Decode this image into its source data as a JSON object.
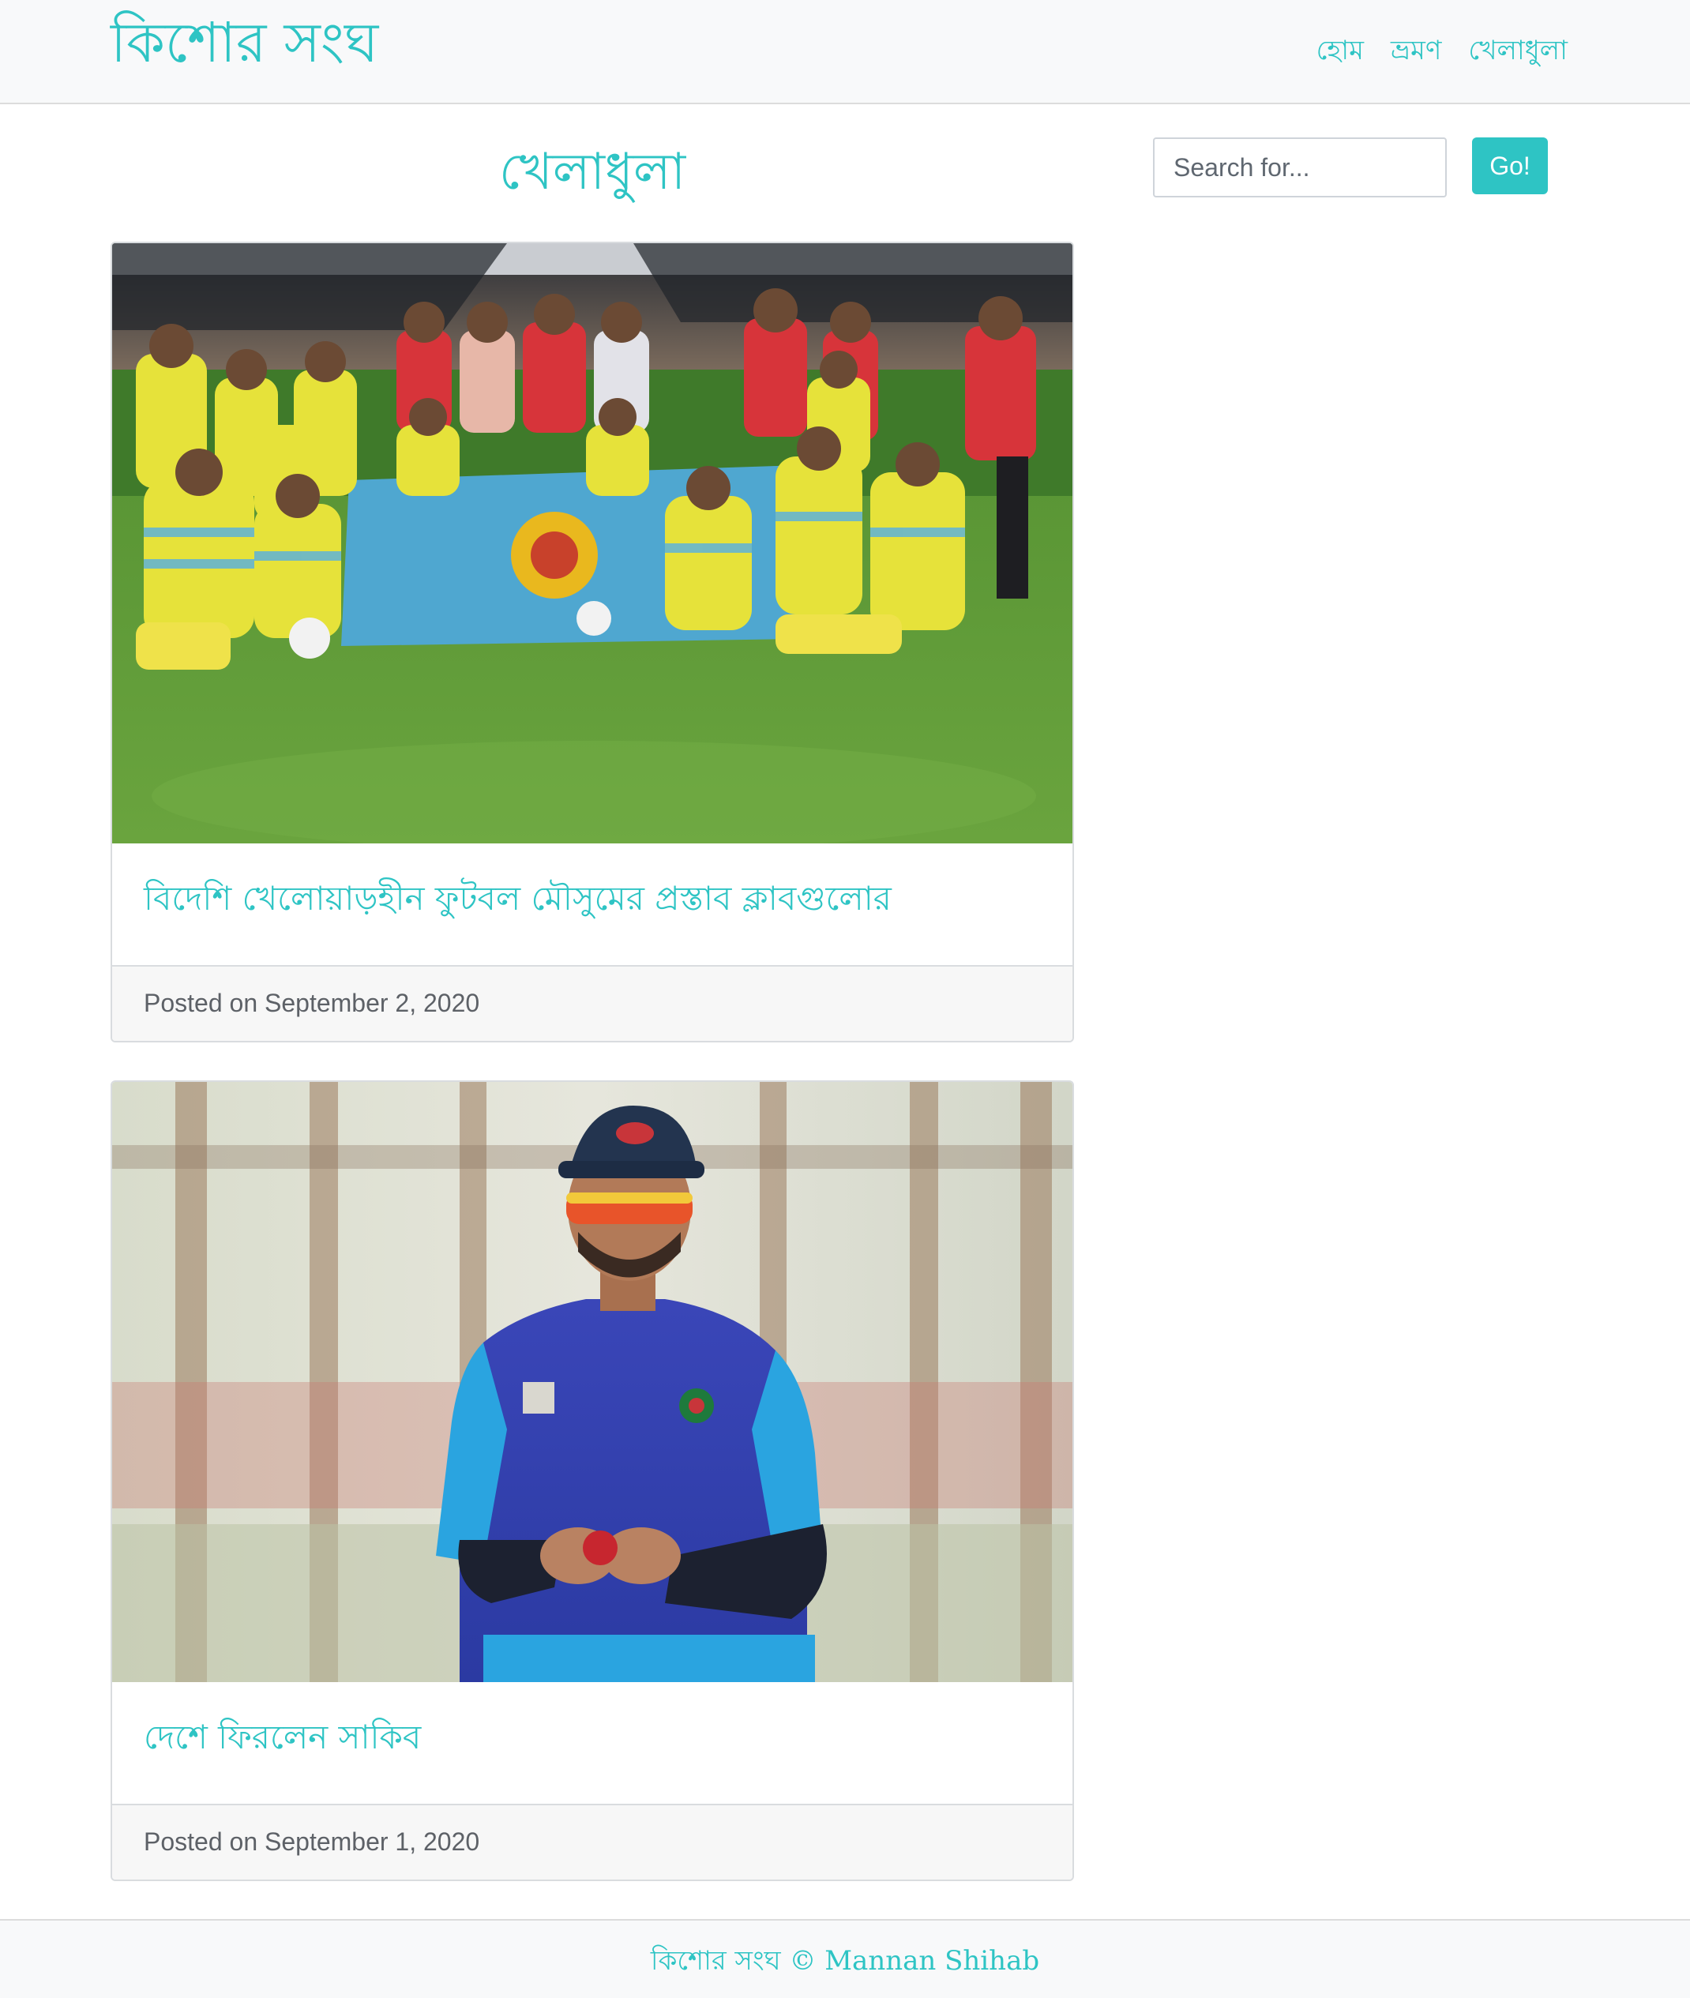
{
  "navbar": {
    "brand": "কিশোর সংঘ",
    "links": [
      "হোম",
      "ভ্রমণ",
      "খেলাধুলা"
    ]
  },
  "page": {
    "heading": "খেলাধুলা"
  },
  "search": {
    "placeholder": "Search for...",
    "button_label": "Go!"
  },
  "posts": [
    {
      "title": "বিদেশি খেলোয়াড়হীন ফুটবল মৌসুমের প্রস্তাব ক্লাবগুলোর",
      "posted": "Posted on September 2, 2020",
      "image": "football-team-photo"
    },
    {
      "title": "দেশে ফিরলেন সাকিব",
      "posted": "Posted on September 1, 2020",
      "image": "cricketer-portrait-photo"
    }
  ],
  "footer": {
    "text": "কিশোর সংঘ © Mannan Shihab"
  },
  "colors": {
    "accent": "#2ec4c4",
    "navbar_bg": "#f8f9fa",
    "card_footer_bg": "#f7f7f7"
  }
}
